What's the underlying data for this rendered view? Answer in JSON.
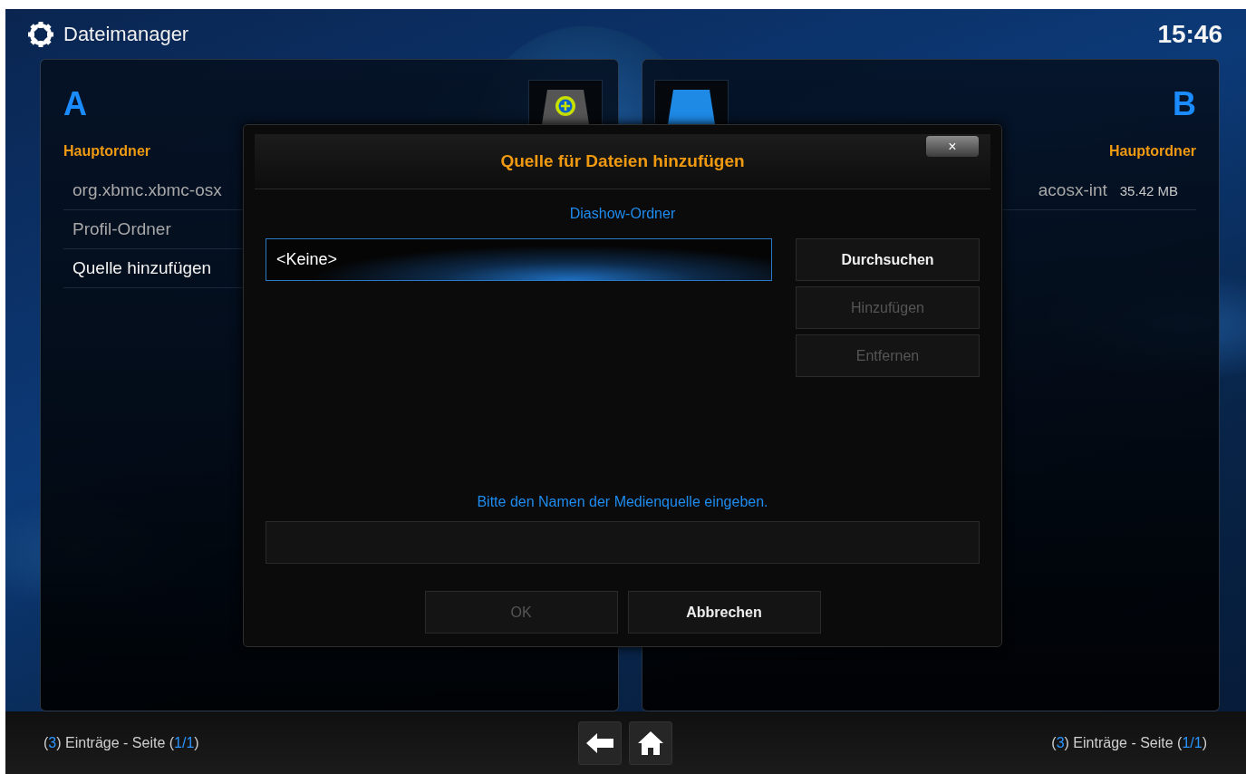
{
  "header": {
    "title": "Dateimanager",
    "clock": "15:46"
  },
  "panels": [
    {
      "letter": "A",
      "heading": "Hauptordner",
      "items": [
        {
          "name": "org.xbmc.xbmc-osx",
          "selected": false
        },
        {
          "name": "Profil-Ordner",
          "selected": false
        },
        {
          "name": "Quelle hinzufügen",
          "selected": true
        }
      ],
      "footer": [
        {
          "text": "(",
          "accent": false
        },
        {
          "text": "3",
          "accent": true
        },
        {
          "text": ") Einträge - Seite (",
          "accent": false
        },
        {
          "text": "1/1",
          "accent": true
        },
        {
          "text": ")",
          "accent": false
        }
      ]
    },
    {
      "letter": "B",
      "heading": "Hauptordner",
      "items": [
        {
          "name": "acosx-int",
          "size": "35.42 MB",
          "selected": false
        }
      ],
      "footer": [
        {
          "text": "(",
          "accent": false
        },
        {
          "text": "3",
          "accent": true
        },
        {
          "text": ") Einträge - Seite (",
          "accent": false
        },
        {
          "text": "1/1",
          "accent": true
        },
        {
          "text": ")",
          "accent": false
        }
      ]
    }
  ],
  "dialog": {
    "title": "Quelle für Dateien hinzufügen",
    "close": "×",
    "subtitle": "Diashow-Ordner",
    "sources": [
      {
        "label": "<Keine>",
        "selected": true
      }
    ],
    "side_buttons": [
      {
        "label": "Durchsuchen",
        "disabled": false
      },
      {
        "label": "Hinzufügen",
        "disabled": true
      },
      {
        "label": "Entfernen",
        "disabled": true
      }
    ],
    "prompt": "Bitte den Namen der Medienquelle eingeben.",
    "buttons": [
      {
        "label": "OK",
        "disabled": true
      },
      {
        "label": "Abbrechen",
        "disabled": false
      }
    ]
  }
}
